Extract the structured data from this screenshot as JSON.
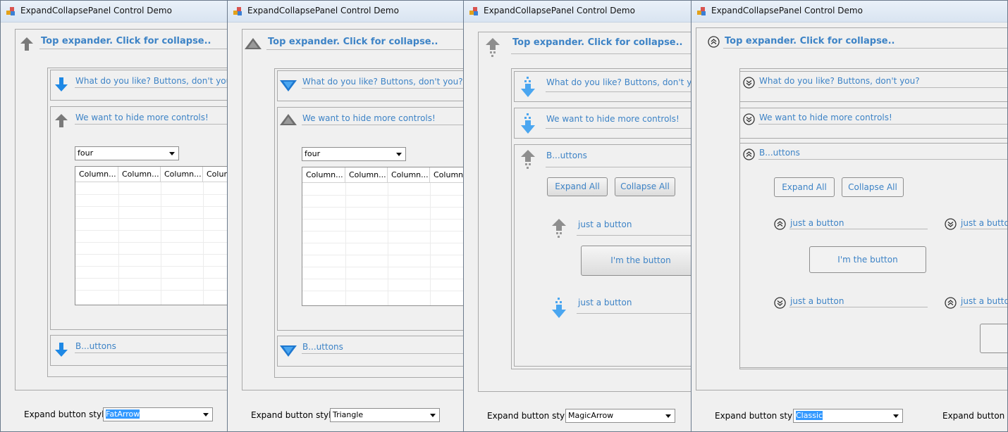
{
  "windows": [
    {
      "title": "ExpandCollapsePanel Control Demo",
      "style": "FatArrow",
      "top_expander": "Top expander. Click for collapse..",
      "panel1": "What do you like? Buttons, don't you?",
      "panel2": "We want to hide more controls!",
      "combo_value": "four",
      "columns": [
        "Column...",
        "Column...",
        "Column...",
        "Column..."
      ],
      "panel3": "B...uttons",
      "bottom_label": "Expand button styles:",
      "bottom_value": "FatArrow"
    },
    {
      "title": "ExpandCollapsePanel Control Demo",
      "style": "Triangle",
      "top_expander": "Top expander. Click for collapse..",
      "panel1": "What do you like? Buttons, don't you?",
      "panel2": "We want to hide more controls!",
      "combo_value": "four",
      "columns": [
        "Column...",
        "Column...",
        "Column...",
        "Column..."
      ],
      "panel3": "B...uttons",
      "bottom_label": "Expand button styles:",
      "bottom_value": "Triangle"
    },
    {
      "title": "ExpandCollapsePanel Control Demo",
      "style": "MagicArrow",
      "top_expander": "Top expander. Click for collapse..",
      "panel1": "What do you like? Buttons, don't you?",
      "panel2": "We want to hide more controls!",
      "panel3": "B...uttons",
      "expand_all": "Expand All",
      "collapse_all": "Collapse All",
      "just_a_button": "just a button",
      "im_the_button": "I'm the button",
      "bottom_label": "Expand button styles:",
      "bottom_value": "MagicArrow"
    },
    {
      "title": "ExpandCollapsePanel Control Demo",
      "style": "Classic",
      "top_expander": "Top expander. Click for collapse..",
      "panel1": "What do you like? Buttons, don't you?",
      "panel2": "We want to hide more controls!",
      "panel3": "B...uttons",
      "expand_all": "Expand All",
      "collapse_all": "Collapse All",
      "just_a_button": "just a button",
      "im_the_button": "I'm the button",
      "bottom_label": "Expand button styles:",
      "bottom_value": "Classic",
      "bottom_label2": "Expand button sizes"
    }
  ],
  "colors": {
    "header_text": "#3d83c6",
    "arrow_blue": "#1e88e5",
    "arrow_gray": "#7a7a7a",
    "selection": "#3399ff"
  }
}
